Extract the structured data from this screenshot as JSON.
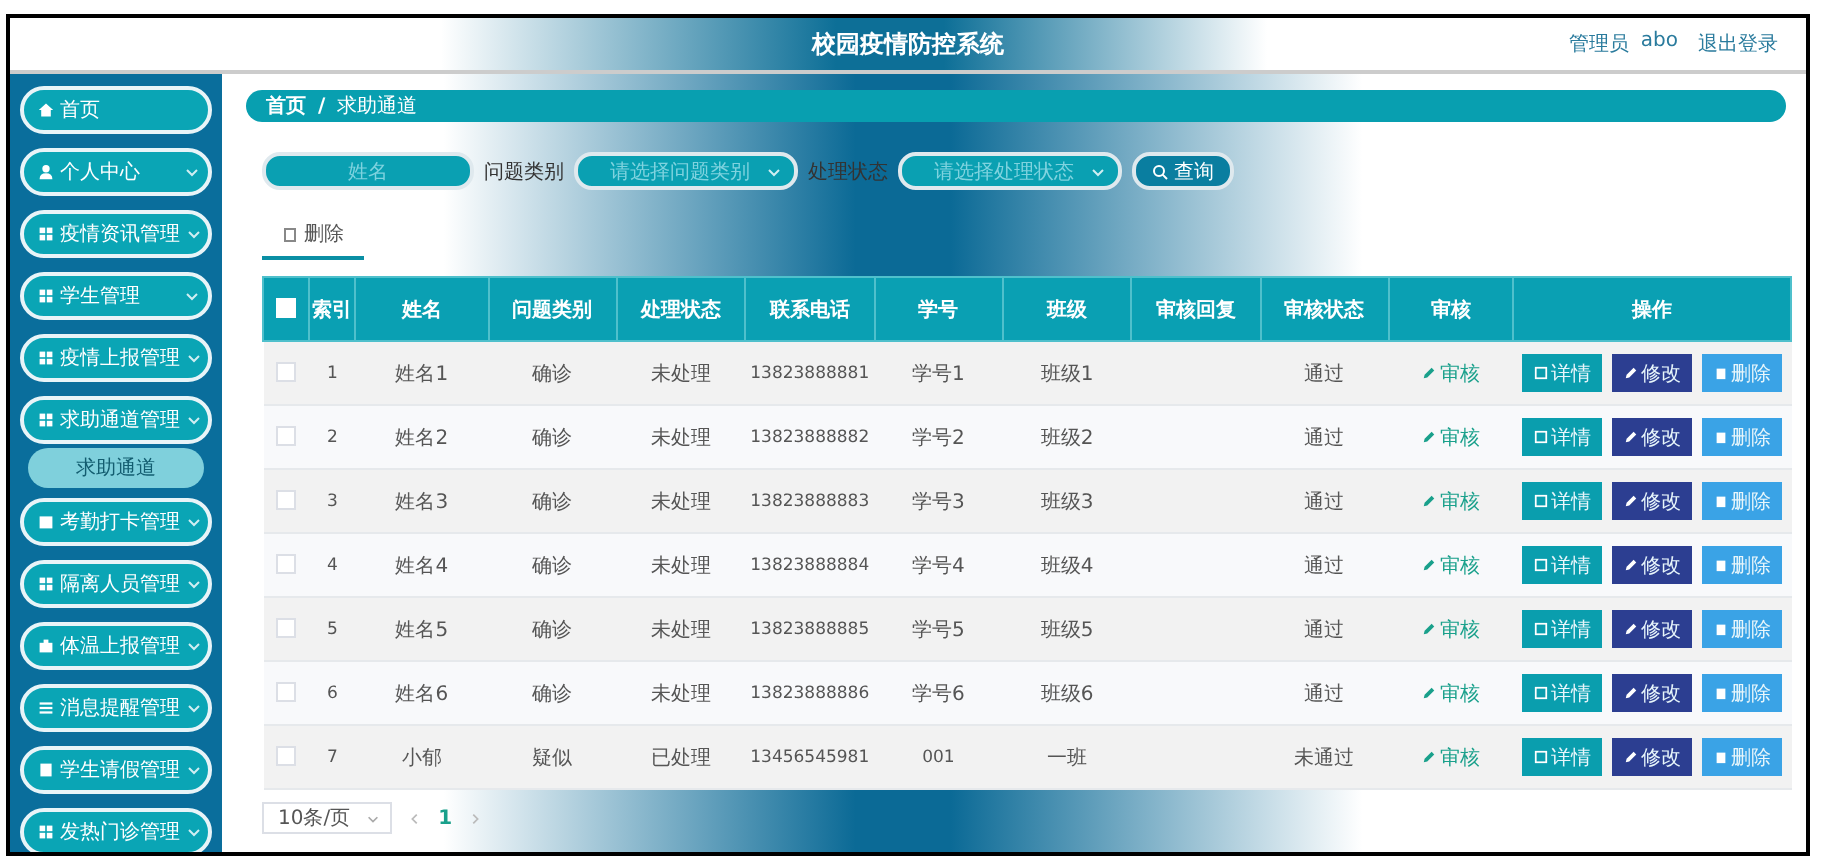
{
  "header": {
    "title": "校园疫情防控系统",
    "user_label": "管理员",
    "username": "abo",
    "logout": "退出登录"
  },
  "sidebar": {
    "items": [
      {
        "label": "首页",
        "kind": "link"
      },
      {
        "label": "个人中心",
        "kind": "menu"
      },
      {
        "label": "疫情资讯管理",
        "kind": "menu"
      },
      {
        "label": "学生管理",
        "kind": "menu"
      },
      {
        "label": "疫情上报管理",
        "kind": "menu"
      },
      {
        "label": "求助通道管理",
        "kind": "menu",
        "children": [
          {
            "label": "求助通道",
            "selected": true
          }
        ]
      },
      {
        "label": "考勤打卡管理",
        "kind": "menu"
      },
      {
        "label": "隔离人员管理",
        "kind": "menu"
      },
      {
        "label": "体温上报管理",
        "kind": "menu"
      },
      {
        "label": "消息提醒管理",
        "kind": "menu"
      },
      {
        "label": "学生请假管理",
        "kind": "menu"
      },
      {
        "label": "发热门诊管理",
        "kind": "menu"
      }
    ]
  },
  "breadcrumb": {
    "home": "首页",
    "separator": "/",
    "current": "求助通道"
  },
  "search": {
    "name_field": {
      "placeholder": "姓名"
    },
    "category_label": "问题类别",
    "category_select": {
      "placeholder": "请选择问题类别"
    },
    "status_label": "处理状态",
    "status_select": {
      "placeholder": "请选择处理状态"
    },
    "query_button": "查询"
  },
  "toolbar": {
    "delete_tab": "删除"
  },
  "table": {
    "all_checked": false,
    "columns": [
      "索引",
      "姓名",
      "问题类别",
      "处理状态",
      "联系电话",
      "学号",
      "班级",
      "审核回复",
      "审核状态",
      "审核",
      "操作"
    ],
    "rows": [
      {
        "checked": false,
        "index": "1",
        "name": "姓名1",
        "category": "确诊",
        "status": "未处理",
        "phone": "13823888881",
        "student_no": "学号1",
        "class": "班级1",
        "audit_status": "通过",
        "audit_link": "审核",
        "actions": [
          "详情",
          "修改",
          "删除"
        ]
      },
      {
        "checked": false,
        "index": "2",
        "name": "姓名2",
        "category": "确诊",
        "status": "未处理",
        "phone": "13823888882",
        "student_no": "学号2",
        "class": "班级2",
        "audit_status": "通过",
        "audit_link": "审核",
        "actions": [
          "详情",
          "修改",
          "删除"
        ]
      },
      {
        "checked": false,
        "index": "3",
        "name": "姓名3",
        "category": "确诊",
        "status": "未处理",
        "phone": "13823888883",
        "student_no": "学号3",
        "class": "班级3",
        "audit_status": "通过",
        "audit_link": "审核",
        "actions": [
          "详情",
          "修改",
          "删除"
        ]
      },
      {
        "checked": false,
        "index": "4",
        "name": "姓名4",
        "category": "确诊",
        "status": "未处理",
        "phone": "13823888884",
        "student_no": "学号4",
        "class": "班级4",
        "audit_status": "通过",
        "audit_link": "审核",
        "actions": [
          "详情",
          "修改",
          "删除"
        ]
      },
      {
        "checked": false,
        "index": "5",
        "name": "姓名5",
        "category": "确诊",
        "status": "未处理",
        "phone": "13823888885",
        "student_no": "学号5",
        "class": "班级5",
        "audit_status": "通过",
        "audit_link": "审核",
        "actions": [
          "详情",
          "修改",
          "删除"
        ]
      },
      {
        "checked": false,
        "index": "6",
        "name": "姓名6",
        "category": "确诊",
        "status": "未处理",
        "phone": "13823888886",
        "student_no": "学号6",
        "class": "班级6",
        "audit_status": "通过",
        "audit_link": "审核",
        "actions": [
          "详情",
          "修改",
          "删除"
        ]
      },
      {
        "checked": false,
        "index": "7",
        "name": "小郁",
        "category": "疑似",
        "status": "已处理",
        "phone": "13456545981",
        "student_no": "001",
        "class": "一班",
        "audit_status": "未通过",
        "audit_link": "审核",
        "actions": [
          "详情",
          "修改",
          "删除"
        ]
      }
    ]
  },
  "pagination": {
    "page_size": "10条/页",
    "pages": [
      {
        "label": "1",
        "selected": true
      }
    ]
  }
}
